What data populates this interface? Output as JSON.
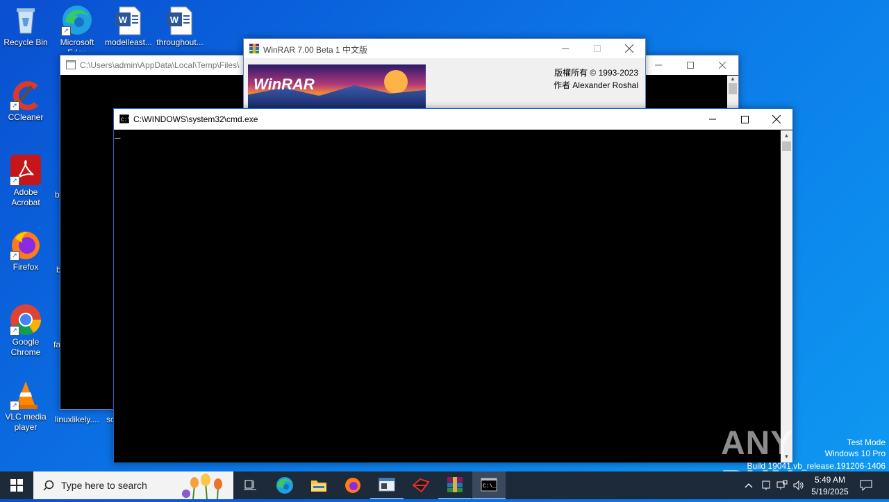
{
  "desktop": {
    "icons": [
      {
        "label": "Recycle Bin"
      },
      {
        "label": "Microsoft Edge"
      },
      {
        "label": "modelleast..."
      },
      {
        "label": "throughout..."
      },
      {
        "label": "CCleaner"
      },
      {
        "label": "Adobe Acrobat"
      },
      {
        "label": "Firefox"
      },
      {
        "label": "Google Chrome"
      },
      {
        "label": "VLC media player"
      },
      {
        "label": "linuxlikely...."
      }
    ],
    "partial_labels": [
      "b",
      "b",
      "fa",
      "sc"
    ]
  },
  "back_window": {
    "title": "C:\\Users\\admin\\AppData\\Local\\Temp\\Files\\"
  },
  "winrar_window": {
    "title": "WinRAR 7.00 Beta 1 中文版",
    "logo_text": "WinRAR",
    "copyright": "版權所有 © 1993-2023",
    "author": "作者 Alexander Roshal"
  },
  "cmd_window": {
    "title": "C:\\WINDOWS\\system32\\cmd.exe",
    "cursor": "_"
  },
  "taskbar": {
    "search_placeholder": "Type here to search",
    "time": "5:49 AM",
    "date": "5/19/2025"
  },
  "watermark": {
    "line1": "Test Mode",
    "line2": "Windows 10 Pro",
    "line3": "Build 19041.vb_release.191206-1406",
    "brand": "ANY RUN"
  },
  "colors": {
    "desktop_bg": "#0b74e6",
    "taskbar_bg": "#1c2a3a",
    "console_bg": "#000000"
  }
}
